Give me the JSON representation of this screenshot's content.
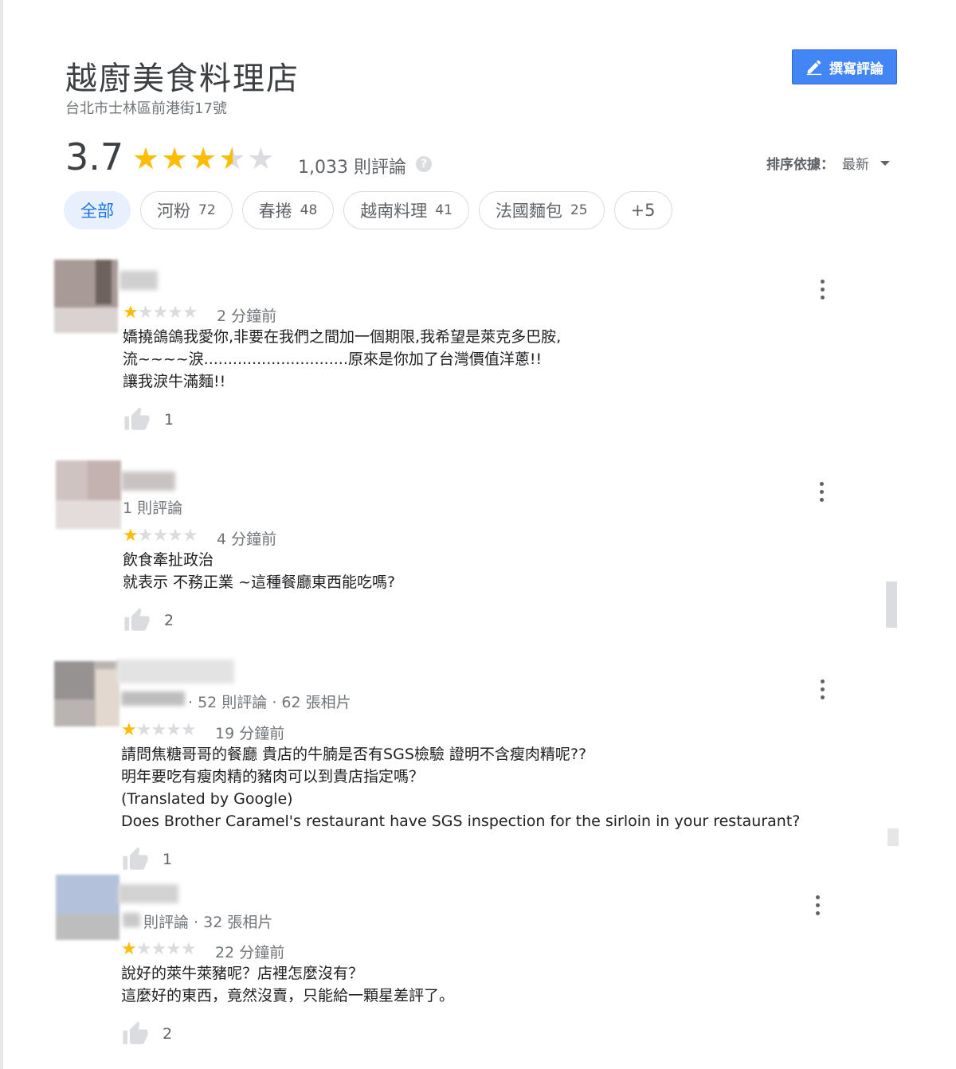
{
  "place": {
    "name": "越廚美食料理店",
    "address": "台北市士林區前港街17號",
    "write_review_label": "撰寫評論"
  },
  "rating": {
    "score": "3.7",
    "stars_value": 3.7,
    "review_count": "1,033 則評論",
    "help_icon": "?"
  },
  "sort": {
    "label": "排序依據：",
    "value": "最新"
  },
  "chips": [
    {
      "label": "全部",
      "count": ""
    },
    {
      "label": "河粉",
      "count": "72"
    },
    {
      "label": "春捲",
      "count": "48"
    },
    {
      "label": "越南料理",
      "count": "41"
    },
    {
      "label": "法國麵包",
      "count": "25"
    },
    {
      "label": "+5",
      "count": ""
    }
  ],
  "reviews": [
    {
      "meta": "",
      "stars": 1,
      "time": "2 分鐘前",
      "text": "嬌撓鴿鴿我愛你,非要在我們之間加一個期限,我希望是萊克多巴胺,\n流~~~~淚..............................原來是你加了台灣價值洋蔥!!\n讓我淚牛滿麵!!",
      "likes": "1"
    },
    {
      "meta": "1 則評論",
      "stars": 1,
      "time": "4 分鐘前",
      "text": "飲食牽扯政治\n就表示 不務正業 ~這種餐廳東西能吃嗎?",
      "likes": "2"
    },
    {
      "meta": "· 52 則評論 · 62 張相片",
      "stars": 1,
      "time": "19 分鐘前",
      "text": "請問焦糖哥哥的餐廳 貴店的牛腩是否有SGS檢驗 證明不含瘦肉精呢??\n明年要吃有瘦肉精的豬肉可以到貴店指定嗎？\n(Translated by Google)\nDoes Brother Caramel's restaurant have SGS inspection for the sirloin in your restaurant?",
      "likes": "1"
    },
    {
      "meta": "則評論 · 32 張相片",
      "stars": 1,
      "time": "22 分鐘前",
      "text": "說好的萊牛萊豬呢？店裡怎麼沒有？\n這麼好的東西，竟然沒賣，只能給一顆星差評了。",
      "likes": "2"
    }
  ],
  "icons": {
    "write": "pencil-icon",
    "help": "help-icon",
    "sort": "caret-down-icon",
    "like": "thumb-up-icon",
    "more": "more-vert-icon"
  },
  "colors": {
    "accent": "#4285f4",
    "star": "#fbbc04",
    "star_empty": "#dadce0",
    "chip_active_bg": "#e8f0fe",
    "chip_active_text": "#1a73e8"
  }
}
